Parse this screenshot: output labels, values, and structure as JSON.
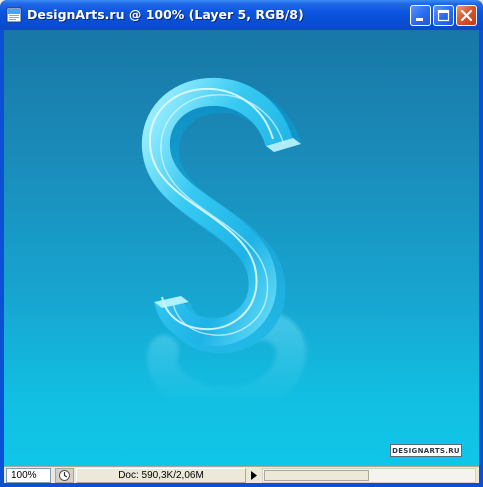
{
  "window": {
    "title": "DesignArts.ru @ 100% (Layer 5, RGB/8)",
    "icon": "photoshop-document-icon"
  },
  "titlebar_buttons": {
    "minimize": "minimize-icon",
    "maximize": "maximize-icon",
    "close": "close-icon"
  },
  "canvas": {
    "letter": "S",
    "watermark": "DESIGNARTS.RU",
    "colors": {
      "bg_top": "#1877a6",
      "bg_bottom": "#10c6e8",
      "glass_letter": "#3fd0f5"
    }
  },
  "statusbar": {
    "zoom": "100%",
    "doc_info": "Doc: 590,3K/2,06M",
    "menu_icon": "status-menu-icon",
    "arrow_icon": "play-arrow-icon",
    "scroll_position": 0.5
  }
}
